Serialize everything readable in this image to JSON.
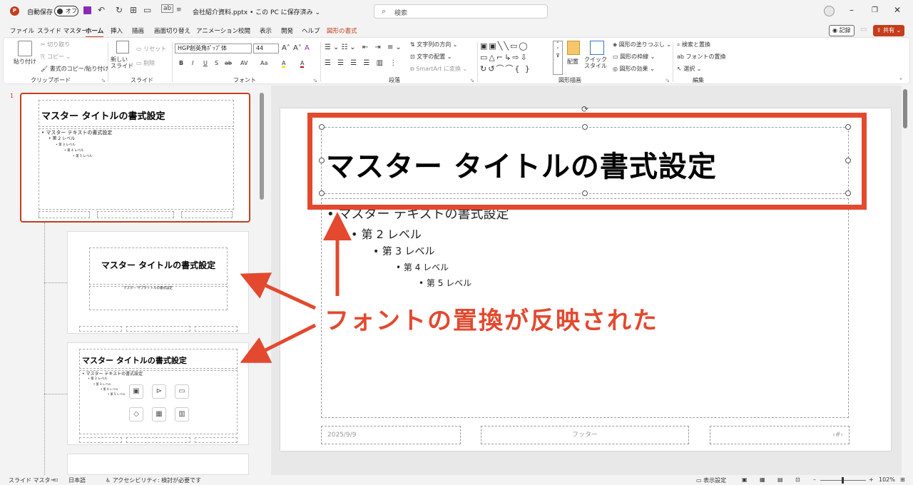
{
  "titlebar": {
    "app_icon": "P",
    "autosave_label": "自動保存",
    "autosave_toggle": "オフ",
    "doc_title": "会社紹介資料.pptx • この PC に保存済み ⌄",
    "search_placeholder": "検索"
  },
  "tabs": [
    "ファイル",
    "スライド マスター",
    "ホーム",
    "挿入",
    "描画",
    "画面切り替え",
    "アニメーション",
    "校閲",
    "表示",
    "開発",
    "ヘルプ",
    "図形の書式"
  ],
  "active_tab": "ホーム",
  "right_buttons": {
    "record": "記録",
    "share": "共有"
  },
  "ribbon": {
    "clipboard": {
      "paste": "貼り付け",
      "cut": "切り取り",
      "copy": "コピー",
      "format_painter": "書式のコピー/貼り付け",
      "label": "クリップボード"
    },
    "slides": {
      "new_slide": "新しい\nスライド",
      "reset": "リセット",
      "delete": "削除",
      "label": "スライド"
    },
    "font": {
      "name": "HGP創英角ﾎﾟｯﾌﾟ体",
      "size": "44",
      "label": "フォント",
      "buttons": [
        "B",
        "I",
        "U",
        "S",
        "ab",
        "AV",
        "Aa",
        "A",
        "A"
      ]
    },
    "paragraph": {
      "text_direction": "文字列の方向",
      "align_text": "文字の配置",
      "smartart": "SmartArt に変換",
      "label": "段落"
    },
    "drawing": {
      "arrange": "配置",
      "quick_styles": "クイック\nスタイル",
      "fill": "図形の塗りつぶし",
      "outline": "図形の枠線",
      "effects": "図形の効果",
      "label": "図形描画"
    },
    "editing": {
      "find": "検索と置換",
      "replace_font": "フォントの置換",
      "select": "選択",
      "label": "編集"
    }
  },
  "thumbnails": {
    "slide_number": "1",
    "master": {
      "title": "マスター タイトルの書式設定",
      "body_l1": "• マスター テキストの書式設定",
      "body_l2": "• 第 2 レベル",
      "body_l3": "• 第 3 レベル",
      "body_l4": "• 第 4 レベル",
      "body_l5": "• 第 5 レベル"
    },
    "layout1": {
      "title": "マスター タイトルの書式設定",
      "subtitle": "マスター サブタイトルの書式設定"
    },
    "layout2": {
      "title": "マスター タイトルの書式設定",
      "body_l1": "• マスター テキストの書式設定",
      "body_l2": "• 第 2 レベル",
      "body_l3": "• 第 3 レベル",
      "body_l4": "• 第 4 レベル",
      "body_l5": "• 第 5 レベル"
    }
  },
  "slide": {
    "title": "マスター タイトルの書式設定",
    "body": [
      "• マスター テキストの書式設定",
      "• 第 2 レベル",
      "• 第 3 レベル",
      "• 第 4 レベル",
      "• 第 5 レベル"
    ],
    "date": "2025/9/9",
    "footer": "フッター",
    "page_number": "‹#›"
  },
  "annotation": "フォントの置換が反映された",
  "status": {
    "mode": "スライド マスター",
    "language": "日本語",
    "accessibility": "アクセシビリティ: 検討が必要です",
    "display_settings": "表示設定",
    "zoom": "102%"
  },
  "colors": {
    "accent": "#c43e1c",
    "annotation": "#e3492f"
  }
}
